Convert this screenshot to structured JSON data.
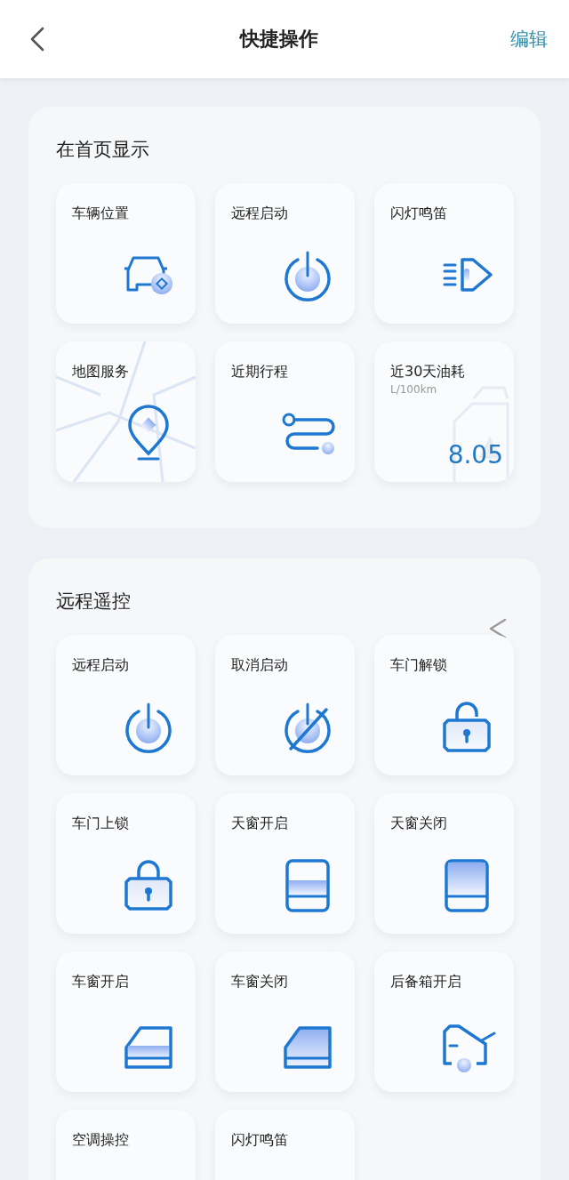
{
  "header": {
    "title": "快捷操作",
    "action": "编辑"
  },
  "sections": [
    {
      "title": "在首页显示",
      "collapse": false,
      "tiles": [
        {
          "label": "车辆位置",
          "kind": "locate"
        },
        {
          "label": "远程启动",
          "kind": "start"
        },
        {
          "label": "闪灯鸣笛",
          "kind": "flash"
        },
        {
          "label": "地图服务",
          "kind": "map"
        },
        {
          "label": "近期行程",
          "kind": "trips"
        },
        {
          "label": "近30天油耗",
          "kind": "fuel",
          "unit": "L/100km",
          "value": "8.05"
        }
      ]
    },
    {
      "title": "远程遥控",
      "collapse": true,
      "tiles": [
        {
          "label": "远程启动",
          "kind": "start"
        },
        {
          "label": "取消启动",
          "kind": "cancel"
        },
        {
          "label": "车门解锁",
          "kind": "unlock"
        },
        {
          "label": "车门上锁",
          "kind": "lock"
        },
        {
          "label": "天窗开启",
          "kind": "roof-open"
        },
        {
          "label": "天窗关闭",
          "kind": "roof-close"
        },
        {
          "label": "车窗开启",
          "kind": "window-open"
        },
        {
          "label": "车窗关闭",
          "kind": "window-close"
        },
        {
          "label": "后备箱开启",
          "kind": "trunk"
        },
        {
          "label": "空调操控",
          "kind": "cut"
        },
        {
          "label": "闪灯鸣笛",
          "kind": "cut"
        }
      ]
    }
  ]
}
